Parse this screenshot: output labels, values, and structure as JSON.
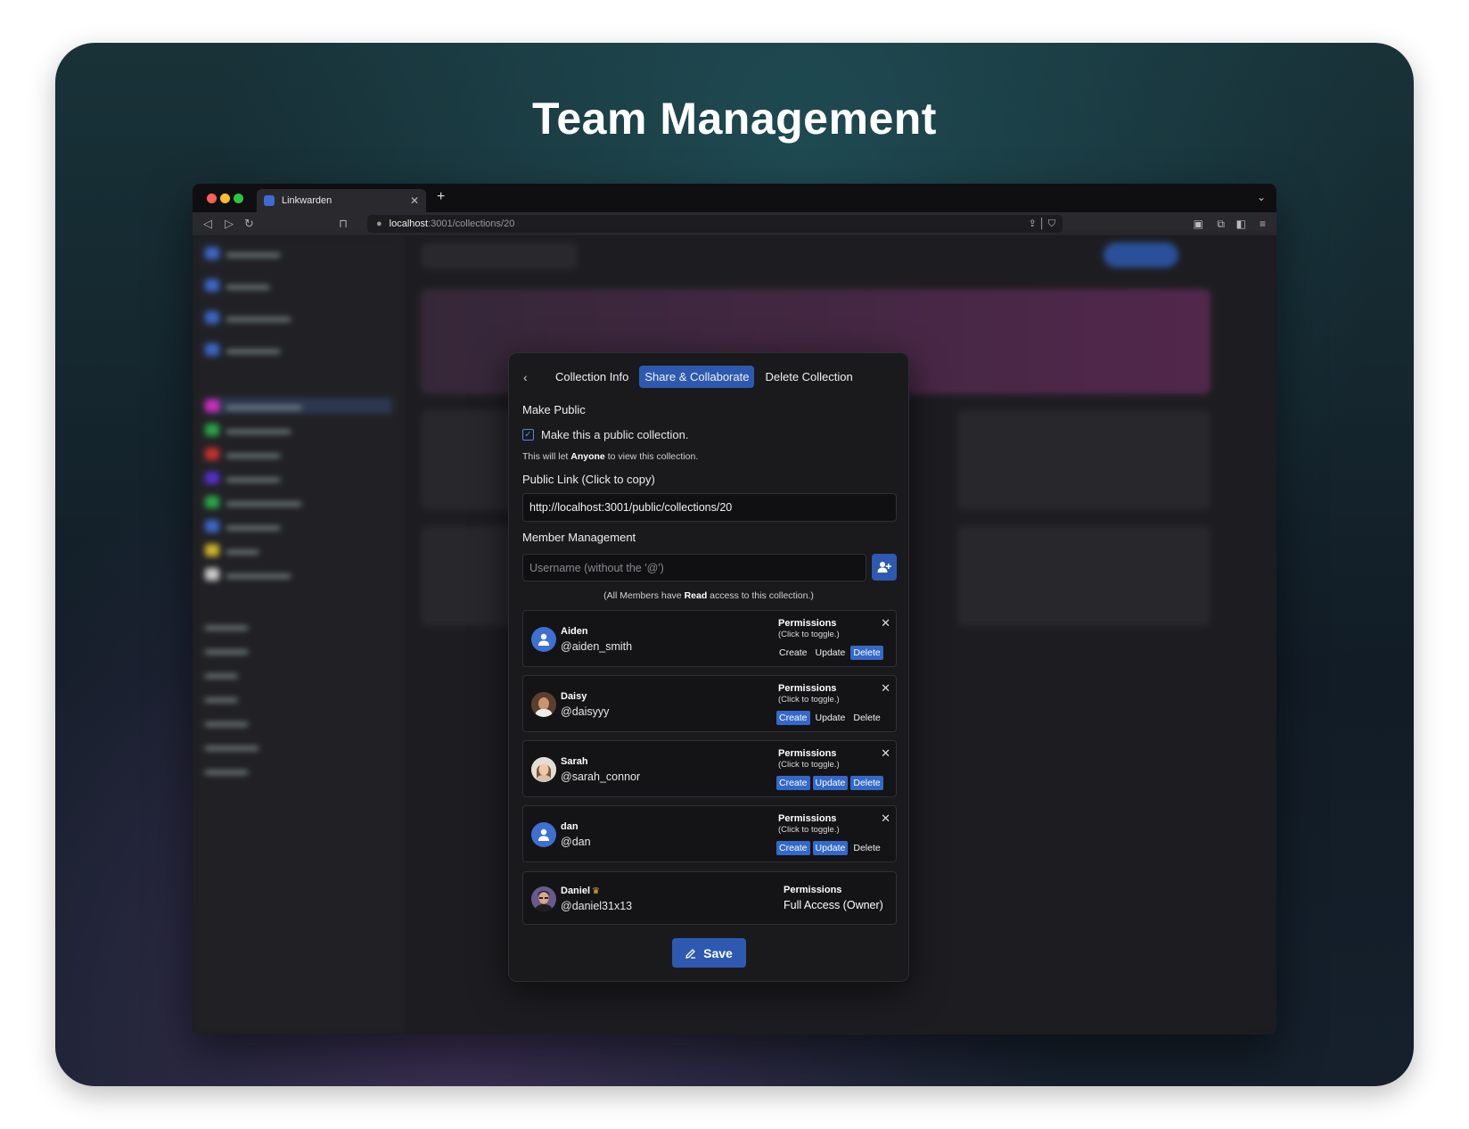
{
  "hero": {
    "title": "Team Management"
  },
  "browser": {
    "tab_title": "Linkwarden",
    "url_host": "localhost",
    "url_path": ":3001/collections/20"
  },
  "modal": {
    "tabs": [
      {
        "label": "Collection Info",
        "active": false
      },
      {
        "label": "Share & Collaborate",
        "active": true
      },
      {
        "label": "Delete Collection",
        "active": false
      }
    ],
    "make_public_label": "Make Public",
    "public_checkbox_label": "Make this a public collection.",
    "public_checked": true,
    "note_prefix": "This will let ",
    "note_bold": "Anyone",
    "note_suffix": " to view this collection.",
    "public_link_label": "Public Link (Click to copy)",
    "public_link": "http://localhost:3001/public/collections/20",
    "member_management_label": "Member Management",
    "username_placeholder": "Username (without the '@')",
    "members_note_prefix": "(All Members have ",
    "members_note_bold": "Read",
    "members_note_suffix": " access to this collection.)",
    "permissions_title": "Permissions",
    "permissions_hint": "(Click to toggle.)",
    "perm_labels": {
      "create": "Create",
      "update": "Update",
      "delete": "Delete"
    },
    "members": [
      {
        "name": "Aiden",
        "username": "@aiden_smith",
        "avatar": "default",
        "create": false,
        "update": false,
        "delete": true
      },
      {
        "name": "Daisy",
        "username": "@daisyyy",
        "avatar": "photo-daisy",
        "create": true,
        "update": false,
        "delete": false
      },
      {
        "name": "Sarah",
        "username": "@sarah_connor",
        "avatar": "photo-sarah",
        "create": true,
        "update": true,
        "delete": true
      },
      {
        "name": "dan",
        "username": "@dan",
        "avatar": "default",
        "create": true,
        "update": true,
        "delete": false
      }
    ],
    "owner": {
      "name": "Daniel",
      "username": "@daniel31x13",
      "permissions_value": "Full Access (Owner)"
    },
    "save_label": "Save"
  },
  "colors": {
    "accent": "#2d5ab0",
    "toggle_on": "#3468c9",
    "crown": "#e0b23a"
  }
}
